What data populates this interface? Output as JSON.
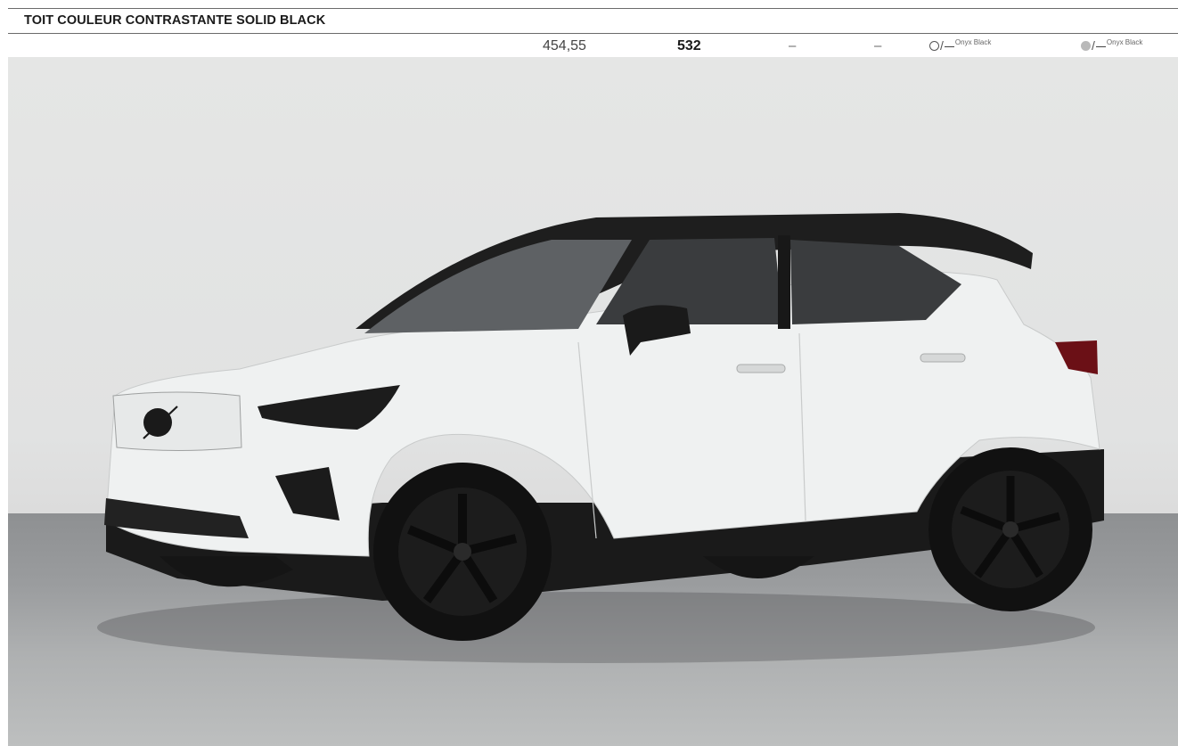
{
  "section": {
    "title": "TOIT COULEUR CONTRASTANTE SOLID BLACK"
  },
  "row": {
    "price": "454,55",
    "value": "532",
    "col3": "–",
    "col4": "–",
    "option1": {
      "symbol": "open-circle",
      "slash": "/",
      "label": "Onyx Black"
    },
    "option2": {
      "symbol": "filled-circle",
      "slash": "/",
      "label": "Onyx Black"
    }
  },
  "image": {
    "subject": "car-photo",
    "body_color": "#eef0f0",
    "roof_color": "#1d1d1d"
  }
}
